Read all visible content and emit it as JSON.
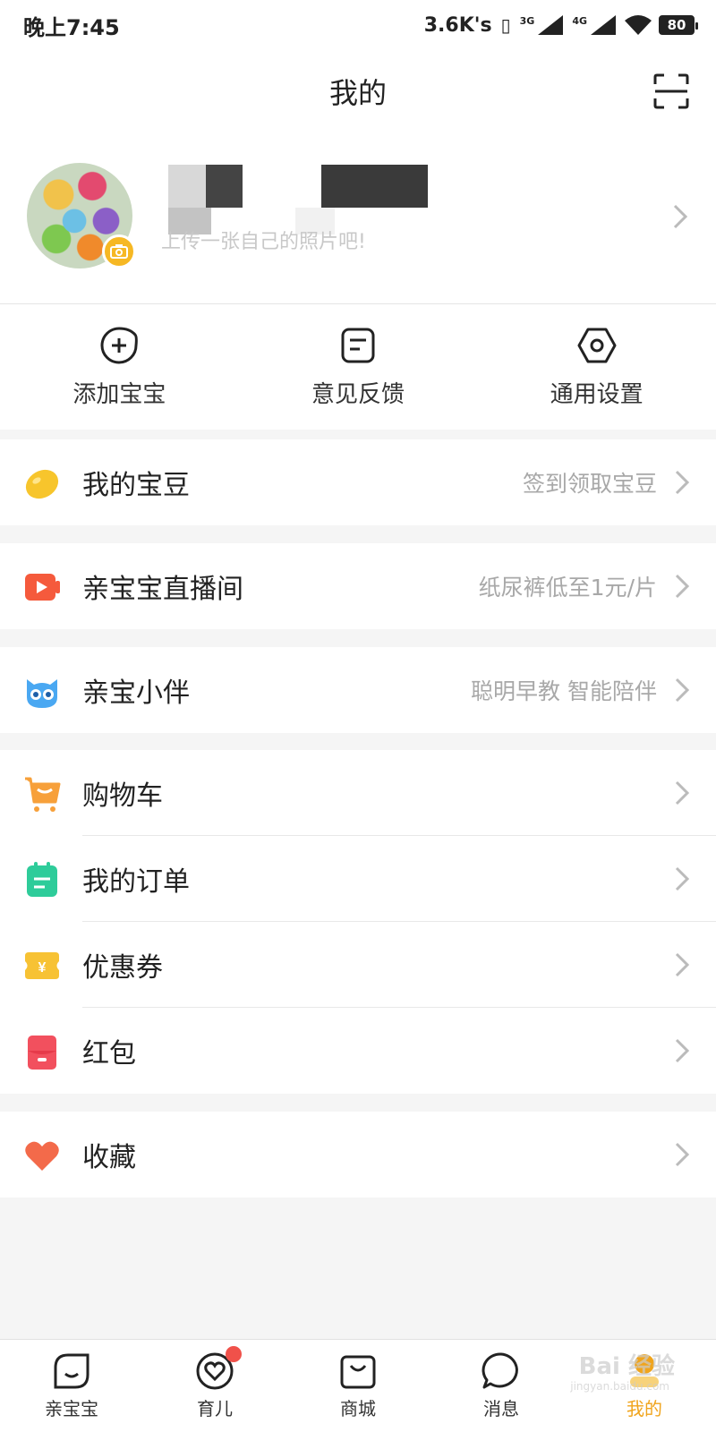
{
  "status": {
    "time": "晚上7:45",
    "speed": "3.6K's",
    "net1": "3G",
    "net2": "4G",
    "battery": "80"
  },
  "header": {
    "title": "我的"
  },
  "profile": {
    "upload_tip": "上传一张自己的照片吧!"
  },
  "quick_actions": [
    {
      "label": "添加宝宝",
      "icon": "add-baby-icon"
    },
    {
      "label": "意见反馈",
      "icon": "feedback-icon"
    },
    {
      "label": "通用设置",
      "icon": "settings-icon"
    }
  ],
  "menu": {
    "beans": {
      "label": "我的宝豆",
      "sub": "签到领取宝豆"
    },
    "live": {
      "label": "亲宝宝直播间",
      "sub": "纸尿裤低至1元/片"
    },
    "companion": {
      "label": "亲宝小伴",
      "sub": "聪明早教 智能陪伴"
    },
    "cart": {
      "label": "购物车"
    },
    "orders": {
      "label": "我的订单"
    },
    "coupons": {
      "label": "优惠券"
    },
    "redpacket": {
      "label": "红包"
    },
    "favorites": {
      "label": "收藏"
    }
  },
  "tabs": [
    {
      "label": "亲宝宝"
    },
    {
      "label": "育儿"
    },
    {
      "label": "商城"
    },
    {
      "label": "消息"
    },
    {
      "label": "我的"
    }
  ],
  "colors": {
    "accent": "#f0a41c",
    "badge": "#f0514a"
  },
  "watermark": {
    "main": "Bai 经验",
    "sub": "jingyan.baidu.com"
  }
}
